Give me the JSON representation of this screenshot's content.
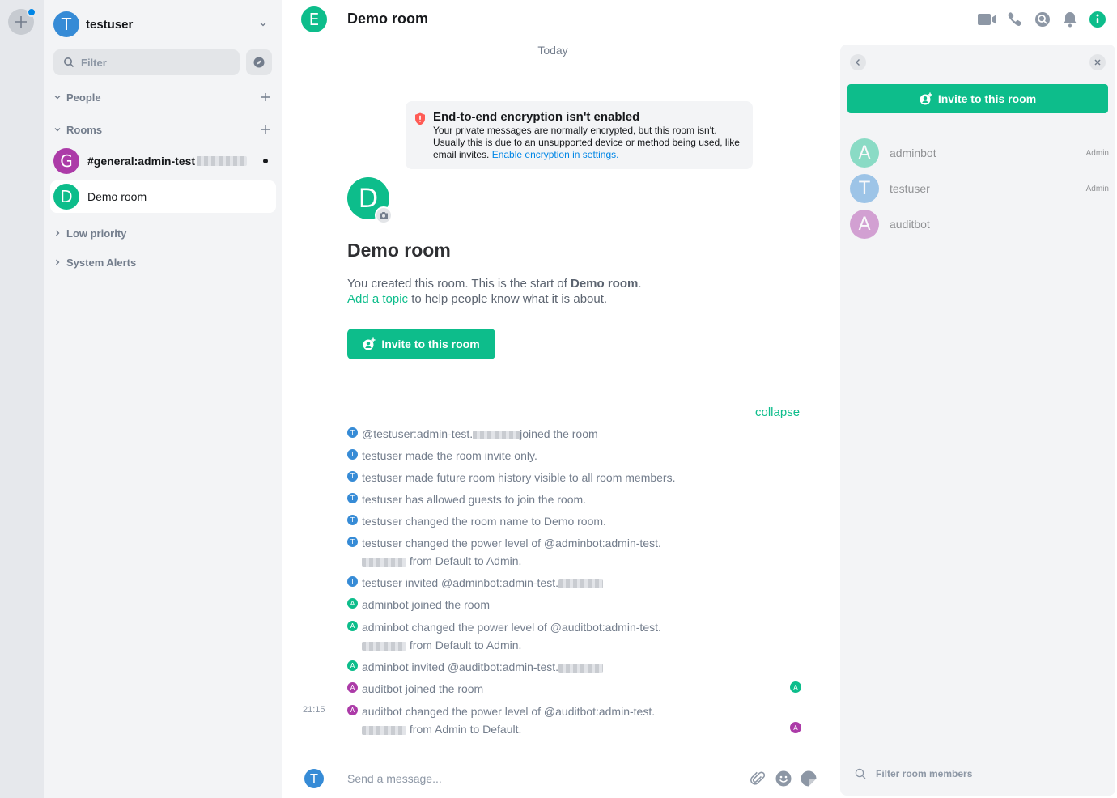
{
  "user": {
    "initial": "T",
    "name": "testuser"
  },
  "roomlist": {
    "filter_placeholder": "Filter",
    "sections": {
      "people": "People",
      "rooms": "Rooms",
      "low_priority": "Low priority",
      "system_alerts": "System Alerts"
    },
    "rooms": [
      {
        "initial": "G",
        "name": "#general:admin-test",
        "color": "#ac3ba8",
        "unread": true
      },
      {
        "initial": "D",
        "name": "Demo room",
        "color": "#0dbd8b",
        "active": true
      }
    ]
  },
  "header": {
    "initial": "E",
    "title": "Demo room",
    "icons": [
      "video-call-icon",
      "voice-call-icon",
      "search-icon",
      "notifications-icon",
      "room-info-icon"
    ]
  },
  "timeline": {
    "date_separator": "Today",
    "e2e_notice": {
      "title": "End-to-end encryption isn't enabled",
      "desc1": "Your private messages are normally encrypted, but this room isn't. Usually this is due to an unsupported device or method being used, like email invites.",
      "link": "Enable encryption in settings."
    },
    "intro": {
      "avatar_initial": "D",
      "title": "Demo room",
      "line1_prefix": "You created this room. This is the start of ",
      "line1_bold": "Demo room",
      "line1_suffix": ".",
      "topic_link": "Add a topic",
      "line2_suffix": " to help people know what it is about.",
      "invite_label": "Invite to this room"
    },
    "collapse_label": "collapse",
    "events": [
      {
        "who": "T",
        "kind": "t",
        "p1": "@testuser:admin-test.",
        "p2": "joined the room"
      },
      {
        "who": "T",
        "kind": "t",
        "p1": "testuser made the room invite only."
      },
      {
        "who": "T",
        "kind": "t",
        "p1": "testuser made future room history visible to all room members."
      },
      {
        "who": "T",
        "kind": "t",
        "p1": "testuser has allowed guests to join the room."
      },
      {
        "who": "T",
        "kind": "t",
        "p1": "testuser changed the room name to Demo room."
      },
      {
        "who": "T",
        "kind": "t",
        "p1": "testuser changed the power level of @adminbot:admin-test.",
        "p2": "from Default to Admin."
      },
      {
        "who": "T",
        "kind": "t",
        "p1": "testuser invited @adminbot:admin-test."
      },
      {
        "who": "A",
        "kind": "a",
        "p1": "adminbot joined the room"
      },
      {
        "who": "A",
        "kind": "a",
        "p1": "adminbot changed the power level of @auditbot:admin-test.",
        "p2": "from Default to Admin."
      },
      {
        "who": "A",
        "kind": "a",
        "p1": "adminbot invited @auditbot:admin-test."
      },
      {
        "who": "A",
        "kind": "u",
        "p1": "auditbot joined the room"
      },
      {
        "who": "A",
        "kind": "u",
        "p1": "auditbot changed the power level of @auditbot:admin-test.",
        "p2": "from Admin to Default."
      }
    ],
    "timestamp": "21:15",
    "read_receipts": [
      "A",
      "A"
    ]
  },
  "composer": {
    "initial": "T",
    "placeholder": "Send a message..."
  },
  "right_panel": {
    "invite_label": "Invite to this room",
    "members": [
      {
        "initial": "A",
        "name": "adminbot",
        "role": "Admin",
        "color": "#0dbd8b"
      },
      {
        "initial": "T",
        "name": "testuser",
        "role": "Admin",
        "color": "#368bd6"
      },
      {
        "initial": "A",
        "name": "auditbot",
        "role": "",
        "color": "#ac3ba8"
      }
    ],
    "filter_placeholder": "Filter room members"
  }
}
